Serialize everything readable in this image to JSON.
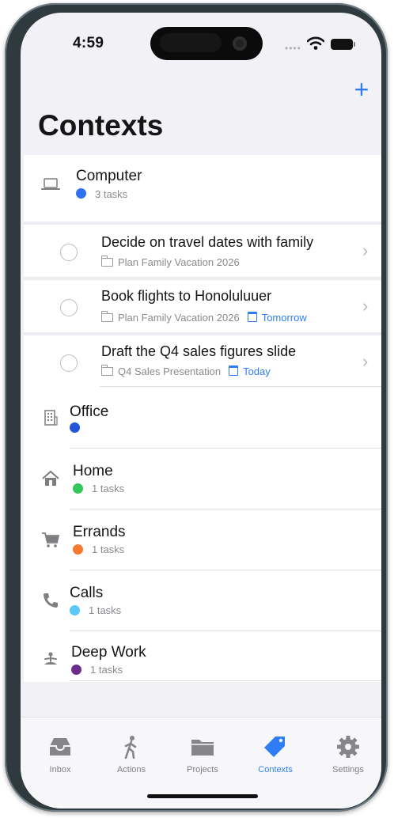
{
  "status": {
    "time": "4:59"
  },
  "header": {
    "title": "Contexts",
    "add_label": "+"
  },
  "contexts": [
    {
      "name": "Computer",
      "count": "3 tasks",
      "color": "#2f6ff0",
      "icon": "laptop-icon",
      "tasks": [
        {
          "title": "Decide on travel dates with family",
          "project": "Plan Family Vacation 2026",
          "due": ""
        },
        {
          "title": "Book flights to Honoluluuer",
          "project": "Plan Family Vacation 2026",
          "due": "Tomorrow"
        },
        {
          "title": "Draft the Q4 sales figures slide",
          "project": "Q4 Sales Presentation",
          "due": "Today"
        }
      ]
    },
    {
      "name": "Office",
      "count": "",
      "color": "#2455d9",
      "icon": "building-icon"
    },
    {
      "name": "Home",
      "count": "1 tasks",
      "color": "#34c759",
      "icon": "house-icon"
    },
    {
      "name": "Errands",
      "count": "1 tasks",
      "color": "#f57a30",
      "icon": "cart-icon"
    },
    {
      "name": "Calls",
      "count": "1 tasks",
      "color": "#5ac8fa",
      "icon": "phone-icon"
    },
    {
      "name": "Deep Work",
      "count": "1 tasks",
      "color": "#6a2e8a",
      "icon": "meditation-icon"
    }
  ],
  "tabs": [
    {
      "label": "Inbox",
      "icon": "tray-icon"
    },
    {
      "label": "Actions",
      "icon": "walking-figure-icon"
    },
    {
      "label": "Projects",
      "icon": "folder-icon"
    },
    {
      "label": "Contexts",
      "icon": "tag-icon",
      "active": true
    },
    {
      "label": "Settings",
      "icon": "gear-icon"
    }
  ],
  "colors": {
    "accent": "#2f7df6"
  }
}
